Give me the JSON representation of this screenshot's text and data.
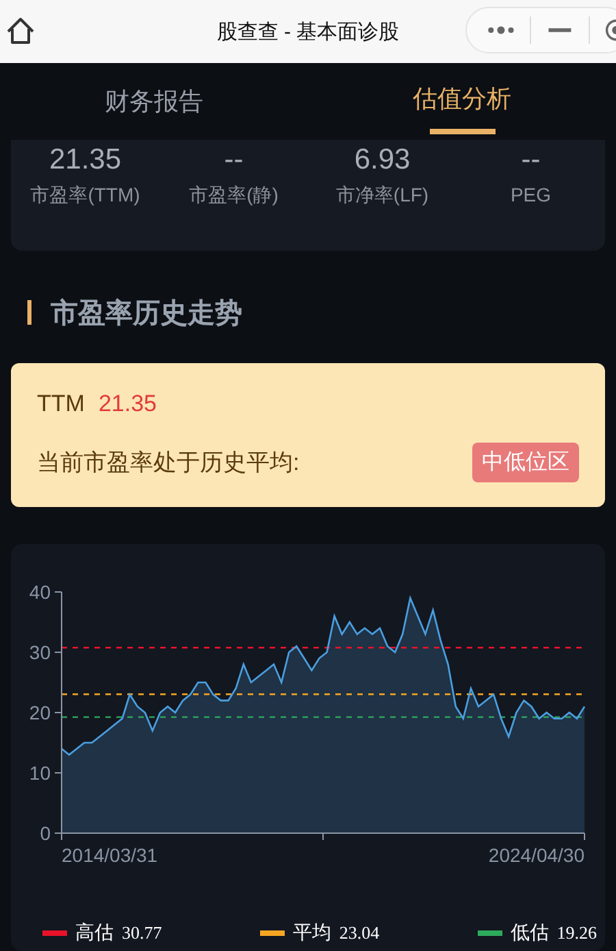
{
  "topbar": {
    "title": "股查查 - 基本面诊股"
  },
  "tabs": [
    {
      "label": "财务报告",
      "selected": false
    },
    {
      "label": "估值分析",
      "selected": true
    }
  ],
  "metrics": [
    {
      "value": "21.35",
      "label": "市盈率(TTM)"
    },
    {
      "value": "--",
      "label": "市盈率(静)"
    },
    {
      "value": "6.93",
      "label": "市净率(LF)"
    },
    {
      "value": "--",
      "label": "PEG"
    }
  ],
  "section_title": "市盈率历史走势",
  "summary": {
    "ttm_label": "TTM",
    "ttm_value": "21.35",
    "text": "当前市盈率处于历史平均:",
    "badge": "中低位区"
  },
  "chart": {
    "chart_data": {
      "type": "area",
      "ylim": [
        0,
        40
      ],
      "yticks": [
        0,
        10,
        20,
        30,
        40
      ],
      "series": [
        {
          "color": "#4a9fe0",
          "values": [
            14,
            13,
            14,
            15,
            15,
            16,
            17,
            18,
            19,
            23,
            21,
            20,
            17,
            20,
            21,
            20,
            22,
            23,
            25,
            25,
            23,
            22,
            22,
            24,
            28,
            25,
            26,
            27,
            28,
            25,
            30,
            31,
            29,
            27,
            29,
            30,
            36,
            33,
            35,
            33,
            34,
            33,
            34,
            31,
            30,
            33,
            39,
            36,
            33,
            37,
            32,
            28,
            21,
            19,
            24,
            21,
            22,
            23,
            19,
            16,
            20,
            22,
            21,
            19,
            20,
            19,
            19,
            20,
            19,
            21
          ]
        },
        {
          "name": "高估",
          "type": "line",
          "line_style": "dashed",
          "color": "#e8132a",
          "values": [
            30.77,
            30.77,
            30.77,
            30.77,
            30.77,
            30.77,
            30.77,
            30.77,
            30.77,
            30.77,
            30.77,
            30.77,
            30.77,
            30.77,
            30.77,
            30.77,
            30.77,
            30.77,
            30.77,
            30.77,
            30.77,
            30.77,
            30.77,
            30.77,
            30.77,
            30.77,
            30.77,
            30.77,
            30.77,
            30.77,
            30.77,
            30.77,
            30.77,
            30.77,
            30.77,
            30.77,
            30.77,
            30.77,
            30.77,
            30.77,
            30.77,
            30.77,
            30.77,
            30.77,
            30.77,
            30.77,
            30.77,
            30.77,
            30.77,
            30.77,
            30.77,
            30.77,
            30.77,
            30.77,
            30.77,
            30.77,
            30.77,
            30.77,
            30.77,
            30.77,
            30.77,
            30.77,
            30.77,
            30.77,
            30.77,
            30.77,
            30.77,
            30.77,
            30.77,
            30.77
          ]
        },
        {
          "name": "平均",
          "type": "line",
          "line_style": "dashed",
          "color": "#f5a623",
          "values": [
            23.04,
            23.04,
            23.04,
            23.04,
            23.04,
            23.04,
            23.04,
            23.04,
            23.04,
            23.04,
            23.04,
            23.04,
            23.04,
            23.04,
            23.04,
            23.04,
            23.04,
            23.04,
            23.04,
            23.04,
            23.04,
            23.04,
            23.04,
            23.04,
            23.04,
            23.04,
            23.04,
            23.04,
            23.04,
            23.04,
            23.04,
            23.04,
            23.04,
            23.04,
            23.04,
            23.04,
            23.04,
            23.04,
            23.04,
            23.04,
            23.04,
            23.04,
            23.04,
            23.04,
            23.04,
            23.04,
            23.04,
            23.04,
            23.04,
            23.04,
            23.04,
            23.04,
            23.04,
            23.04,
            23.04,
            23.04,
            23.04,
            23.04,
            23.04,
            23.04,
            23.04,
            23.04,
            23.04,
            23.04,
            23.04,
            23.04,
            23.04,
            23.04,
            23.04,
            23.04
          ]
        },
        {
          "name": "低估",
          "type": "line",
          "line_style": "dashed",
          "color": "#2eaa5c",
          "values": [
            19.26,
            19.26,
            19.26,
            19.26,
            19.26,
            19.26,
            19.26,
            19.26,
            19.26,
            19.26,
            19.26,
            19.26,
            19.26,
            19.26,
            19.26,
            19.26,
            19.26,
            19.26,
            19.26,
            19.26,
            19.26,
            19.26,
            19.26,
            19.26,
            19.26,
            19.26,
            19.26,
            19.26,
            19.26,
            19.26,
            19.26,
            19.26,
            19.26,
            19.26,
            19.26,
            19.26,
            19.26,
            19.26,
            19.26,
            19.26,
            19.26,
            19.26,
            19.26,
            19.26,
            19.26,
            19.26,
            19.26,
            19.26,
            19.26,
            19.26,
            19.26,
            19.26,
            19.26,
            19.26,
            19.26,
            19.26,
            19.26,
            19.26,
            19.26,
            19.26,
            19.26,
            19.26,
            19.26,
            19.26,
            19.26,
            19.26,
            19.26,
            19.26,
            19.26,
            19.26
          ]
        }
      ]
    },
    "x_labels": [
      "2014/03/31",
      "2024/04/30"
    ],
    "legend_values": [
      "30.77",
      "23.04",
      "19.26"
    ]
  }
}
